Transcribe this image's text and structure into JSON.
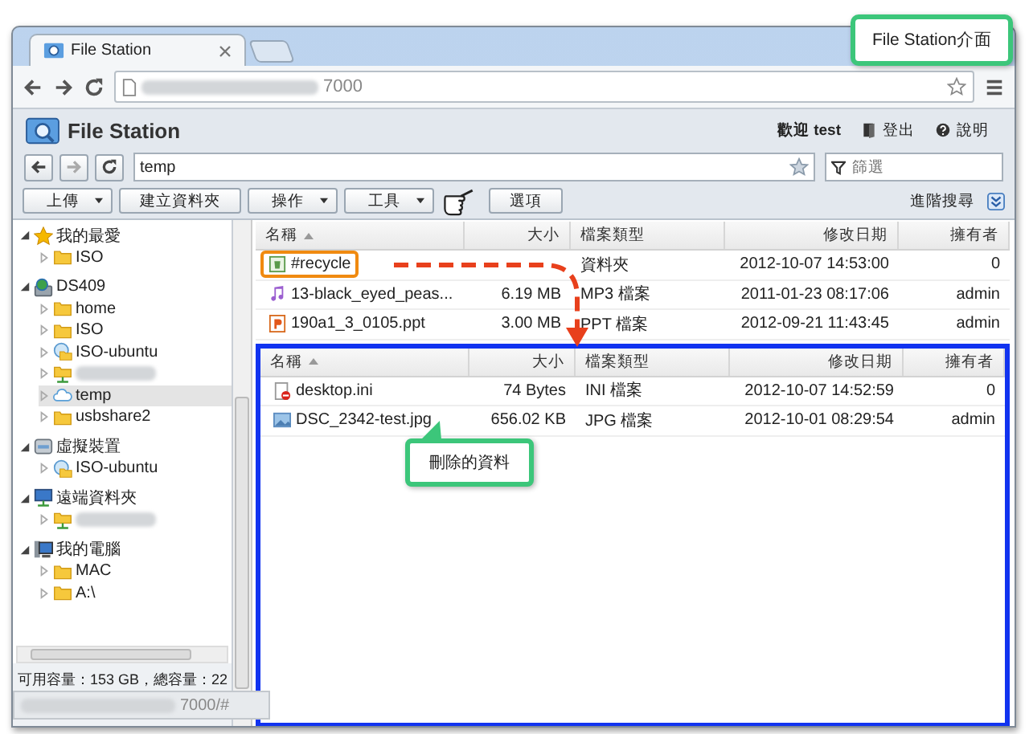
{
  "browser": {
    "tab_title": "File Station",
    "url_visible": "7000",
    "status_url_visible": "7000/#"
  },
  "app": {
    "title": "File Station",
    "welcome": "歡迎 test",
    "logout": "登出",
    "help": "說明"
  },
  "nav": {
    "path": "temp",
    "filter_placeholder": "篩選"
  },
  "toolbar": {
    "buttons": [
      {
        "label": "上傳",
        "dropdown": true
      },
      {
        "label": "建立資料夾",
        "dropdown": false
      },
      {
        "label": "操作",
        "dropdown": true
      },
      {
        "label": "工具",
        "dropdown": true
      },
      {
        "label": "選項",
        "dropdown": false
      }
    ],
    "advanced_search": "進階搜尋"
  },
  "sidebar": {
    "tree": [
      {
        "kind": "favorites",
        "label": "我的最愛",
        "expanded": true,
        "selected": false,
        "children": [
          {
            "kind": "folder",
            "label": "ISO",
            "expanded": false,
            "selected": false
          }
        ]
      },
      {
        "kind": "server",
        "label": "DS409",
        "expanded": true,
        "selected": false,
        "children": [
          {
            "kind": "folder",
            "label": "home",
            "expanded": false,
            "selected": false
          },
          {
            "kind": "folder",
            "label": "ISO",
            "expanded": false,
            "selected": false
          },
          {
            "kind": "mounted",
            "label": "ISO-ubuntu",
            "expanded": false,
            "selected": false
          },
          {
            "kind": "remote",
            "blurred": true,
            "expanded": false,
            "selected": false
          },
          {
            "kind": "cloud",
            "label": "temp",
            "expanded": false,
            "selected": true
          },
          {
            "kind": "folder",
            "label": "usbshare2",
            "expanded": false,
            "selected": false
          }
        ]
      },
      {
        "kind": "virtual",
        "label": "虛擬裝置",
        "expanded": true,
        "selected": false,
        "children": [
          {
            "kind": "mounted",
            "label": "ISO-ubuntu",
            "expanded": false,
            "selected": false
          }
        ]
      },
      {
        "kind": "remote-root",
        "label": "遠端資料夾",
        "expanded": true,
        "selected": false,
        "children": [
          {
            "kind": "remote",
            "blurred": true,
            "expanded": false,
            "selected": false
          }
        ]
      },
      {
        "kind": "pc",
        "label": "我的電腦",
        "expanded": true,
        "selected": false,
        "children": [
          {
            "kind": "folder",
            "label": "MAC",
            "expanded": false,
            "selected": false
          },
          {
            "kind": "folder",
            "label": "A:\\",
            "expanded": false,
            "selected": false
          }
        ]
      }
    ],
    "free_space": "可用容量：153 GB，總容量：22"
  },
  "file_list": {
    "columns": [
      {
        "label": "名稱",
        "sorted": true
      },
      {
        "label": "大小",
        "sorted": false
      },
      {
        "label": "檔案類型",
        "sorted": false
      },
      {
        "label": "修改日期",
        "sorted": false
      },
      {
        "label": "擁有者",
        "sorted": false
      }
    ],
    "rows": [
      {
        "kind": "recycle",
        "name": "#recycle",
        "type": "資料夾",
        "modified": "2012-10-07 14:53:00",
        "owner": "0",
        "highlighted": true
      },
      {
        "kind": "audio",
        "name": "13-black_eyed_peas...",
        "size": "6.19 MB",
        "type": "MP3 檔案",
        "modified": "2011-01-23 08:17:06",
        "owner": "admin",
        "highlighted": false
      },
      {
        "kind": "ppt",
        "name": "190a1_3_0105.ppt",
        "size": "3.00 MB",
        "type": "PPT 檔案",
        "modified": "2012-09-21 11:43:45",
        "owner": "admin",
        "highlighted": false
      }
    ]
  },
  "deleted_list": {
    "columns": [
      {
        "label": "名稱",
        "sorted": true
      },
      {
        "label": "大小",
        "sorted": false
      },
      {
        "label": "檔案類型",
        "sorted": false
      },
      {
        "label": "修改日期",
        "sorted": false
      },
      {
        "label": "擁有者",
        "sorted": false
      }
    ],
    "rows": [
      {
        "kind": "ini",
        "name": "desktop.ini",
        "size": "74 Bytes",
        "type": "INI 檔案",
        "modified": "2012-10-07 14:52:59",
        "owner": "0",
        "highlighted": false
      },
      {
        "kind": "image",
        "name": "DSC_2342-test.jpg",
        "size": "656.02 KB",
        "type": "JPG 檔案",
        "modified": "2012-10-01 08:29:54",
        "owner": "admin",
        "highlighted": false
      }
    ]
  },
  "annotations": [
    {
      "kind": "title-callout",
      "text": "File Station介面"
    },
    {
      "kind": "pointer-callout",
      "text": "刪除的資料"
    }
  ]
}
